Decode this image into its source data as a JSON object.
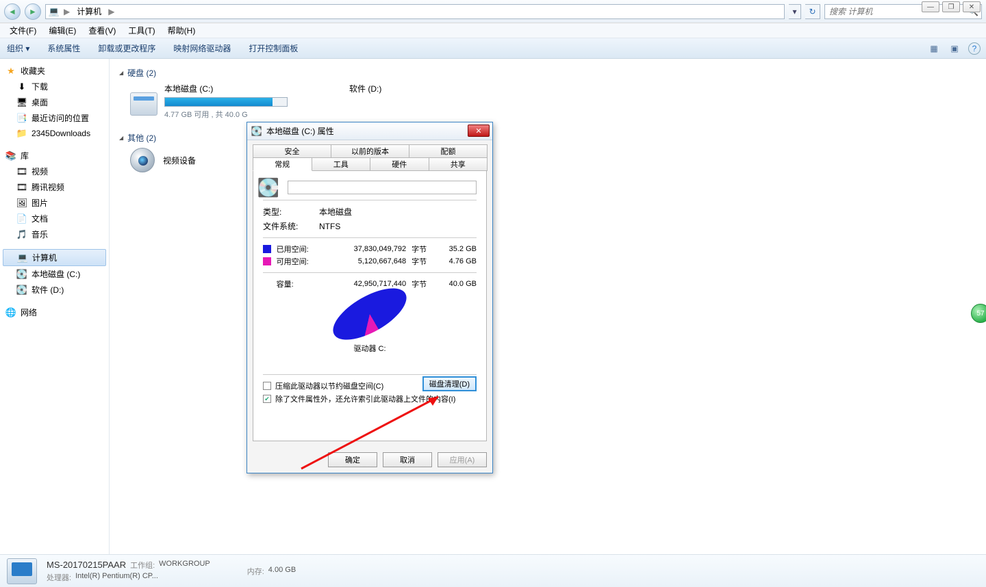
{
  "window_controls": {
    "min": "—",
    "max": "❐",
    "close": "✕"
  },
  "nav": {
    "back_icon": "◄",
    "fwd_icon": "►",
    "crumb_root": "计算机",
    "sep": "▶",
    "dropdown_icon": "▾",
    "refresh_icon": "↻",
    "search_placeholder": "搜索 计算机",
    "search_icon": "🔍"
  },
  "menubar": [
    "文件(F)",
    "编辑(E)",
    "查看(V)",
    "工具(T)",
    "帮助(H)"
  ],
  "toolbar": {
    "items": [
      "组织 ▾",
      "系统属性",
      "卸载或更改程序",
      "映射网络驱动器",
      "打开控制面板"
    ],
    "view_icon": "▦",
    "preview_icon": "▣",
    "help_icon": "?"
  },
  "sidebar": {
    "fav_head": "收藏夹",
    "fav_star": "★",
    "fav_items": [
      {
        "icon": "⬇",
        "label": "下载"
      },
      {
        "icon": "🖥",
        "label": "桌面"
      },
      {
        "icon": "📑",
        "label": "最近访问的位置"
      },
      {
        "icon": "📁",
        "label": "2345Downloads"
      }
    ],
    "lib_head": "库",
    "lib_icon": "📚",
    "lib_items": [
      {
        "icon": "🎞",
        "label": "视频"
      },
      {
        "icon": "🎞",
        "label": "腾讯视频"
      },
      {
        "icon": "🖼",
        "label": "图片"
      },
      {
        "icon": "📄",
        "label": "文档"
      },
      {
        "icon": "🎵",
        "label": "音乐"
      }
    ],
    "comp_head": "计算机",
    "comp_icon": "💻",
    "comp_items": [
      {
        "icon": "💽",
        "label": "本地磁盘 (C:)"
      },
      {
        "icon": "💽",
        "label": "软件 (D:)"
      }
    ],
    "net_head": "网络",
    "net_icon": "🌐"
  },
  "main": {
    "cat_disk": "硬盘 (2)",
    "drives": [
      {
        "name": "本地磁盘 (C:)",
        "sub": "4.77 GB 可用 , 共 40.0 G",
        "fill_pct": 88
      },
      {
        "name": "软件 (D:)",
        "sub": "",
        "fill_pct": 0
      }
    ],
    "cat_other": "其他 (2)",
    "other_item": "视频设备"
  },
  "dialog": {
    "title": "本地磁盘 (C:) 属性",
    "tabs_row1": [
      "安全",
      "以前的版本",
      "配额"
    ],
    "tabs_row2": [
      "常规",
      "工具",
      "硬件",
      "共享"
    ],
    "type_label": "类型:",
    "type_value": "本地磁盘",
    "fs_label": "文件系统:",
    "fs_value": "NTFS",
    "used_label": "已用空间:",
    "used_bytes": "37,830,049,792",
    "bytes_unit": "字节",
    "used_gb": "35.2 GB",
    "free_label": "可用空间:",
    "free_bytes": "5,120,667,648",
    "free_gb": "4.76 GB",
    "cap_label": "容量:",
    "cap_bytes": "42,950,717,440",
    "cap_gb": "40.0 GB",
    "drive_label": "驱动器 C:",
    "cleanup_btn": "磁盘清理(D)",
    "compress_chk": "压缩此驱动器以节约磁盘空间(C)",
    "index_chk": "除了文件属性外，还允许索引此驱动器上文件的内容(I)",
    "ok": "确定",
    "cancel": "取消",
    "apply": "应用(A)",
    "colors": {
      "used": "#1a1adf",
      "free": "#e619b6"
    }
  },
  "statusbar": {
    "host": "MS-20170215PAAR",
    "wg_label": "工作组:",
    "wg_value": "WORKGROUP",
    "cpu_label": "处理器:",
    "cpu_value": "Intel(R) Pentium(R) CP...",
    "mem_label": "内存:",
    "mem_value": "4.00 GB"
  },
  "bubble": "57",
  "chart_data": {
    "type": "pie",
    "title": "驱动器 C:",
    "series": [
      {
        "name": "已用空间",
        "value": 35.2,
        "unit": "GB",
        "color": "#1a1adf"
      },
      {
        "name": "可用空间",
        "value": 4.76,
        "unit": "GB",
        "color": "#e619b6"
      }
    ],
    "total": {
      "label": "容量",
      "value": 40.0,
      "unit": "GB"
    }
  }
}
